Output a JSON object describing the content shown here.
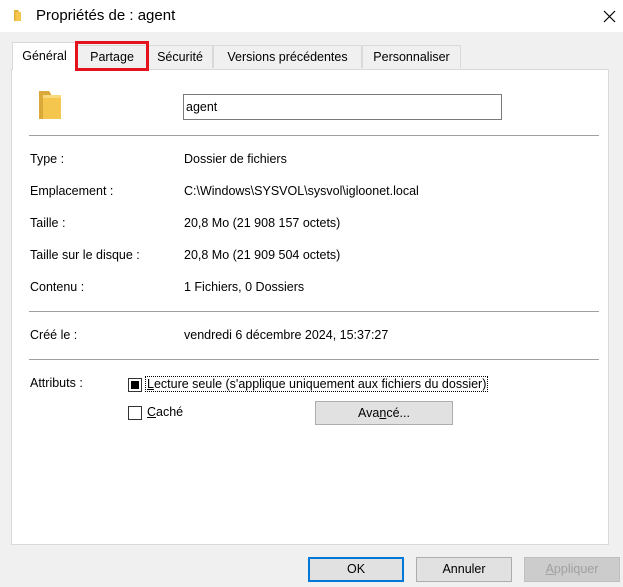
{
  "window": {
    "title": "Propriétés de : agent",
    "folder_icon": "folder-icon",
    "close_icon": "close-icon"
  },
  "tabs": [
    {
      "label": "Général",
      "active": true
    },
    {
      "label": "Partage",
      "active": false,
      "highlighted": true
    },
    {
      "label": "Sécurité",
      "active": false
    },
    {
      "label": "Versions précédentes",
      "active": false
    },
    {
      "label": "Personnaliser",
      "active": false
    }
  ],
  "general": {
    "name_value": "agent",
    "properties": [
      {
        "label": "Type :",
        "value": "Dossier de fichiers"
      },
      {
        "label": "Emplacement :",
        "value": "C:\\Windows\\SYSVOL\\sysvol\\igloonet.local"
      },
      {
        "label": "Taille :",
        "value": "20,8 Mo (21 908 157 octets)"
      },
      {
        "label": "Taille sur le disque :",
        "value": "20,8 Mo (21 909 504 octets)"
      },
      {
        "label": "Contenu :",
        "value": "1 Fichiers, 0 Dossiers"
      }
    ],
    "created": {
      "label": "Créé le :",
      "value": "vendredi 6 décembre 2024, 15:37:27"
    },
    "attributes": {
      "label": "Attributs :",
      "readonly": {
        "label_prefix": "L",
        "label_rest": "ecture seule (s'applique uniquement aux fichiers du dossier)",
        "state": "indeterminate"
      },
      "hidden": {
        "label_prefix": "C",
        "label_rest": "aché",
        "checked": false
      },
      "advanced_button": {
        "label_prefix": "Ava",
        "label_key": "n",
        "label_rest": "cé..."
      }
    }
  },
  "footer": {
    "ok": "OK",
    "cancel": "Annuler",
    "apply_key": "A",
    "apply_rest": "ppliquer"
  },
  "colors": {
    "highlight": "#e3121c",
    "default_button_border": "#0078d7",
    "folder": "#f5c64e"
  }
}
